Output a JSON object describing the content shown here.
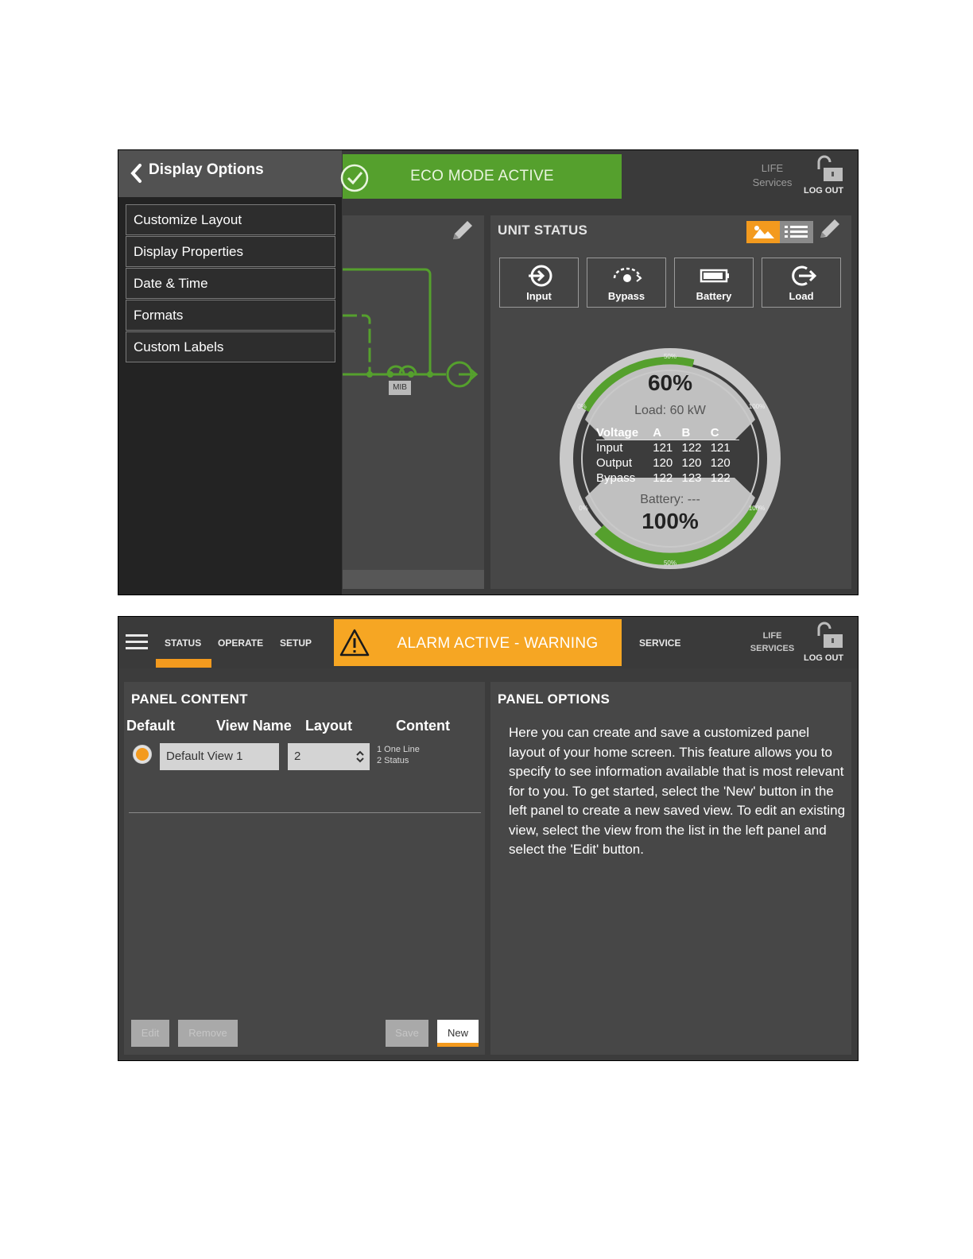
{
  "screen1": {
    "sidebar": {
      "title": "Display Options",
      "items": [
        {
          "label": "Customize Layout"
        },
        {
          "label": "Display Properties"
        },
        {
          "label": "Date & Time"
        },
        {
          "label": "Formats"
        },
        {
          "label": "Custom Labels"
        }
      ]
    },
    "banner": {
      "text": "ECO MODE ACTIVE",
      "color": "#55a02d"
    },
    "header": {
      "life_line1": "LIFE",
      "life_line2": "Services",
      "logout": "LOG OUT"
    },
    "oneline": {
      "mib_label": "MIB"
    },
    "unit_status": {
      "title": "UNIT STATUS",
      "tiles": [
        {
          "label": "Input",
          "icon": "input-arrow-icon"
        },
        {
          "label": "Bypass",
          "icon": "bypass-icon"
        },
        {
          "label": "Battery",
          "icon": "battery-icon"
        },
        {
          "label": "Load",
          "icon": "load-icon"
        }
      ],
      "gauge": {
        "load_percent": "60%",
        "load_text": "Load: 60 kW",
        "battery_text": "Battery: ---",
        "battery_percent": "100%",
        "tick_labels": [
          "50%",
          "100%",
          "0%",
          "0%",
          "100%",
          "50%"
        ],
        "voltage_table": {
          "headers": [
            "Voltage",
            "A",
            "B",
            "C"
          ],
          "rows": [
            {
              "name": "Input",
              "a": "121",
              "b": "122",
              "c": "121"
            },
            {
              "name": "Output",
              "a": "120",
              "b": "120",
              "c": "120"
            },
            {
              "name": "Bypass",
              "a": "122",
              "b": "123",
              "c": "122"
            }
          ]
        }
      }
    }
  },
  "screen2": {
    "nav": {
      "status": "STATUS",
      "operate": "OPERATE",
      "setup": "SETUP",
      "service": "SERVICE"
    },
    "alarm": {
      "text": "ALARM ACTIVE - WARNING",
      "color": "#f6a623"
    },
    "header": {
      "life_line1": "LIFE",
      "life_line2": "SERVICES",
      "logout": "LOG OUT"
    },
    "panel_content": {
      "title": "PANEL CONTENT",
      "columns": {
        "default": "Default",
        "view_name": "View Name",
        "layout": "Layout",
        "content": "Content"
      },
      "row": {
        "view_name": "Default View 1",
        "layout": "2",
        "content": [
          "1 One Line",
          "2 Status"
        ]
      },
      "buttons": {
        "edit": "Edit",
        "remove": "Remove",
        "save": "Save",
        "new": "New"
      }
    },
    "panel_options": {
      "title": "PANEL OPTIONS",
      "text": "Here you can create and save a customized panel layout of your home screen. This feature allows you to specify to see information available that is most relevant for to you. To get started, select the 'New' button in the left panel to create a new saved view. To edit an existing view, select the view from the list in the left panel and select the 'Edit' button."
    },
    "accent_color": "#f39a1e"
  }
}
